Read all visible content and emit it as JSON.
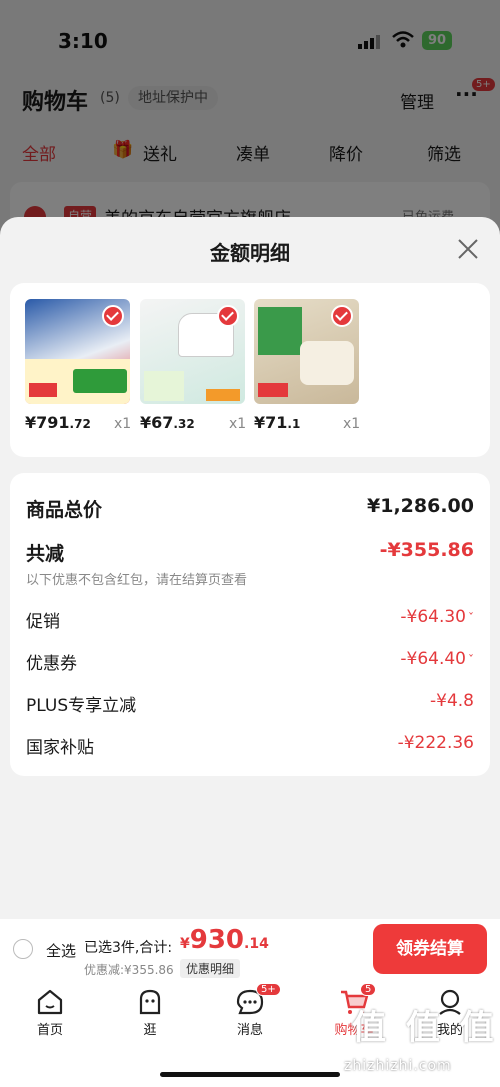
{
  "status": {
    "time": "3:10",
    "battery": "90"
  },
  "cart": {
    "title": "购物车",
    "count": "(5)",
    "address": "地址保护中",
    "manage": "管理",
    "more_badge": "5+"
  },
  "tabs": [
    "全部",
    "送礼",
    "凑单",
    "降价",
    "筛选"
  ],
  "store": {
    "tag": "自营",
    "name": "美的京东自营官方旗舰店",
    "ship": "已免运费"
  },
  "sheet": {
    "title": "金额明细",
    "products": [
      {
        "price_int": "¥791",
        "price_dec": ".72",
        "qty": "x1",
        "color": "#3b6fb8"
      },
      {
        "price_int": "¥67",
        "price_dec": ".32",
        "qty": "x1",
        "color": "#cfe9e0"
      },
      {
        "price_int": "¥71",
        "price_dec": ".1",
        "qty": "x1",
        "color": "#d9cbb2"
      }
    ],
    "total_label": "商品总价",
    "total_value": "¥1,286.00",
    "reduce_label": "共减",
    "reduce_value": "-¥355.86",
    "note": "以下优惠不包含红包，请在结算页查看",
    "promo_label": "促销",
    "promo_value": "-¥64.30",
    "coupon_label": "优惠券",
    "coupon_value": "-¥64.40",
    "plus_label": "PLUS专享立减",
    "plus_value": "-¥4.8",
    "subsidy_label": "国家补贴",
    "subsidy_value": "-¥222.36"
  },
  "checkout": {
    "select_all": "全选",
    "selected": "已选3件,合计:",
    "currency": "¥",
    "total_int": "930",
    "total_dec": ".14",
    "discount": "优惠减:¥355.86",
    "detail_btn": "优惠明细",
    "pay_btn": "领券结算"
  },
  "tabbar": [
    {
      "label": "首页"
    },
    {
      "label": "逛"
    },
    {
      "label": "消息",
      "badge": "5+"
    },
    {
      "label": "购物车",
      "badge": "5"
    },
    {
      "label": "我的"
    }
  ],
  "watermark": {
    "text": "值 值 值",
    "url": "zhizhizhi.com"
  },
  "colors": {
    "accent": "#e4393c"
  }
}
